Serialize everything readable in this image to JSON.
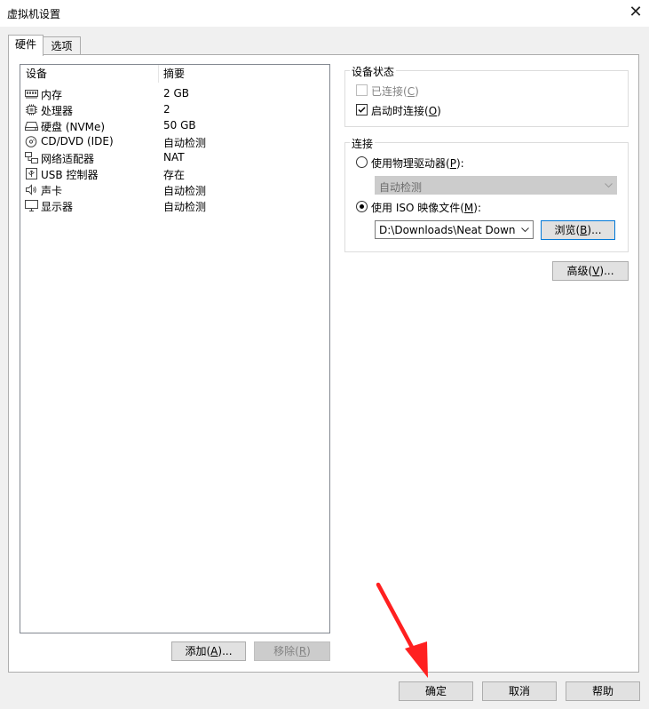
{
  "window": {
    "title": "虚拟机设置",
    "close_glyph": "✕"
  },
  "tabs": [
    {
      "label": "硬件"
    },
    {
      "label": "选项"
    }
  ],
  "device_list": {
    "col_device": "设备",
    "col_summary": "摘要",
    "rows": [
      {
        "name": "内存",
        "summary": "2 GB",
        "icon": "memory-icon"
      },
      {
        "name": "处理器",
        "summary": "2",
        "icon": "cpu-icon"
      },
      {
        "name": "硬盘 (NVMe)",
        "summary": "50 GB",
        "icon": "hard-disk-icon"
      },
      {
        "name": "CD/DVD (IDE)",
        "summary": "自动检测",
        "icon": "cd-dvd-icon"
      },
      {
        "name": "网络适配器",
        "summary": "NAT",
        "icon": "network-adapter-icon"
      },
      {
        "name": "USB 控制器",
        "summary": "存在",
        "icon": "usb-icon"
      },
      {
        "name": "声卡",
        "summary": "自动检测",
        "icon": "speaker-icon"
      },
      {
        "name": "显示器",
        "summary": "自动检测",
        "icon": "monitor-icon"
      }
    ]
  },
  "buttons": {
    "add": {
      "text": "添加(",
      "key": "A",
      "suffix": ")..."
    },
    "remove": {
      "text": "移除(",
      "key": "R",
      "suffix": ")"
    },
    "ok": "确定",
    "cancel": "取消",
    "help": "帮助"
  },
  "device_status": {
    "title": "设备状态",
    "connected": {
      "text": "已连接(",
      "key": "C",
      "suffix": ")",
      "checked": false,
      "enabled": false
    },
    "connect_at_power_on": {
      "text": "启动时连接(",
      "key": "O",
      "suffix": ")",
      "checked": true
    }
  },
  "connection": {
    "title": "连接",
    "use_physical": {
      "text": "使用物理驱动器(",
      "key": "P",
      "suffix": "):",
      "selected": false
    },
    "physical_drive_value": "自动检测",
    "use_iso": {
      "text": "使用 ISO 映像文件(",
      "key": "M",
      "suffix": "):",
      "selected": true
    },
    "iso_path": "D:\\Downloads\\Neat Downlo",
    "browse": {
      "text": "浏览(",
      "key": "B",
      "suffix": ")..."
    }
  },
  "advanced": {
    "text": "高级(",
    "key": "V",
    "suffix": ")..."
  },
  "colors": {
    "accent": "#0078d7",
    "annotation_arrow": "#ff2020"
  }
}
